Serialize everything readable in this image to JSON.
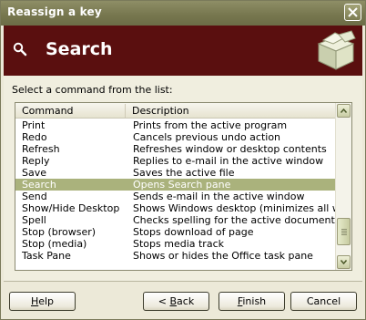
{
  "window": {
    "title": "Reassign a key"
  },
  "header": {
    "title": "Search"
  },
  "instruction": "Select a command from the list:",
  "list": {
    "columns": [
      "Command",
      "Description"
    ],
    "rows": [
      {
        "command": "Print",
        "description": "Prints from the active program"
      },
      {
        "command": "Redo",
        "description": "Cancels previous undo action"
      },
      {
        "command": "Refresh",
        "description": "Refreshes window or desktop contents"
      },
      {
        "command": "Reply",
        "description": "Replies to e-mail in the active window"
      },
      {
        "command": "Save",
        "description": "Saves the active file"
      },
      {
        "command": "Search",
        "description": "Opens Search pane",
        "selected": true
      },
      {
        "command": "Send",
        "description": "Sends e-mail in the active window"
      },
      {
        "command": "Show/Hide Desktop",
        "description": "Shows Windows desktop (minimizes all win..."
      },
      {
        "command": "Spell",
        "description": "Checks spelling for the active document"
      },
      {
        "command": "Stop (browser)",
        "description": "Stops download of page"
      },
      {
        "command": "Stop (media)",
        "description": "Stops media track"
      },
      {
        "command": "Task Pane",
        "description": "Shows or hides the Office task pane"
      }
    ]
  },
  "buttons": {
    "help": {
      "mnemonic": "H",
      "rest": "elp"
    },
    "back": {
      "pre": "< ",
      "mnemonic": "B",
      "rest": "ack"
    },
    "finish": {
      "mnemonic": "F",
      "rest": "inish"
    },
    "cancel": "Cancel"
  },
  "icons": {
    "close": "close-icon",
    "search": "magnifier-icon",
    "header_graphic": "open-box-icon",
    "scroll_up": "chevron-up-icon",
    "scroll_down": "chevron-down-icon"
  },
  "colors": {
    "titlebar": "#76764e",
    "header": "#5a0f0f",
    "selection": "#aab27c",
    "dialog_bg": "#ece9d8"
  }
}
